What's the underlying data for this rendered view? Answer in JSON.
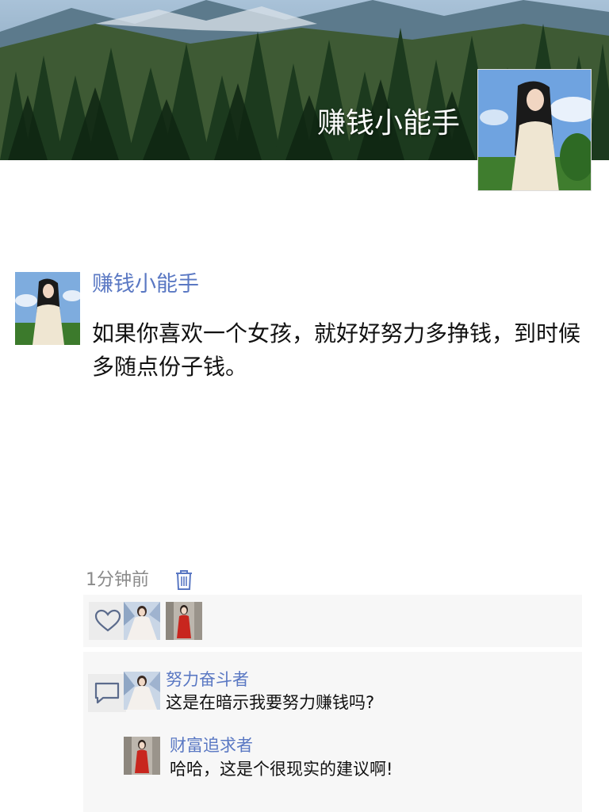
{
  "profile": {
    "cover_name": "赚钱小能手"
  },
  "post": {
    "author": "赚钱小能手",
    "text": "如果你喜欢一个女孩，就好好努力多挣钱，到时候多随点份子钱。",
    "time": "1分钟前"
  },
  "likes": {
    "icon": "heart-icon",
    "users": [
      "like-avatar-1",
      "like-avatar-2"
    ]
  },
  "comments": {
    "icon": "comment-icon",
    "items": [
      {
        "name": "努力奋斗者",
        "text": "这是在暗示我要努力赚钱吗?"
      },
      {
        "name": "财富追求者",
        "text": "哈哈，这是个很现实的建议啊!"
      }
    ]
  },
  "colors": {
    "link": "#5a78c3",
    "panel": "#f7f7f7",
    "text": "#111111",
    "muted": "#8a8a8a"
  }
}
